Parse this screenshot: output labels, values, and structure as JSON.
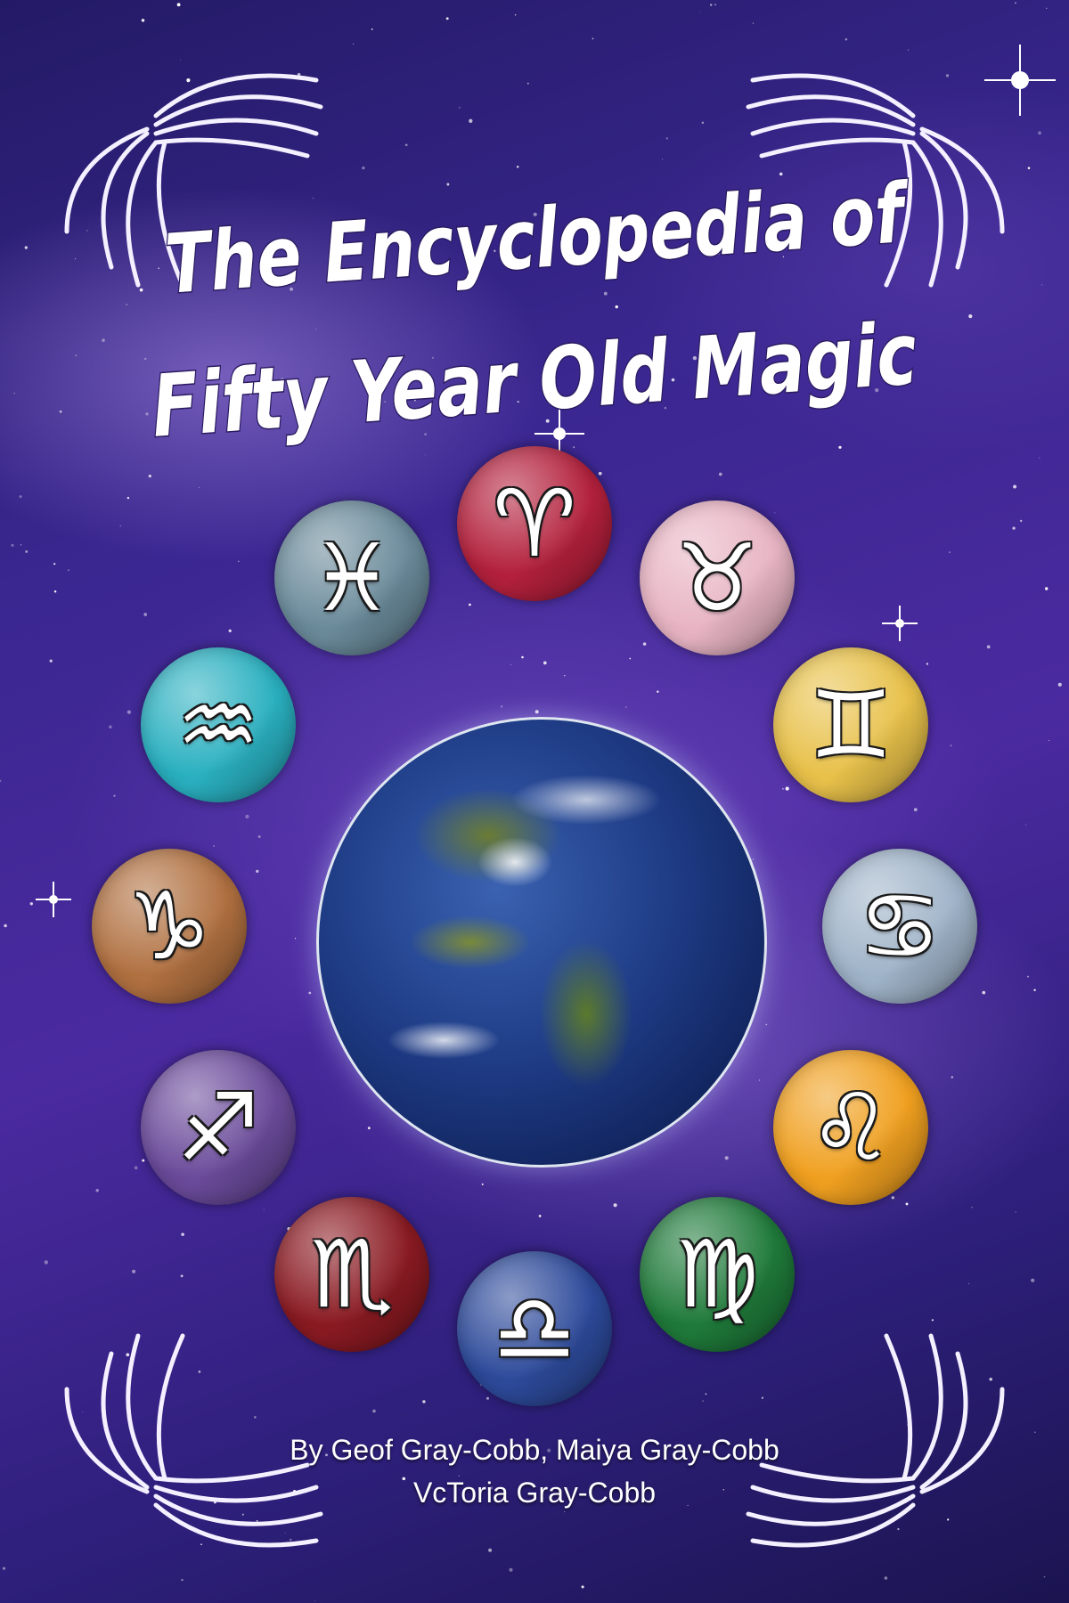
{
  "cover": {
    "title_line1": "The Encyclopedia of",
    "title_line2": "Fifty Year Old Magic",
    "authors_line1": "By Geof Gray-Cobb,  Maiya Gray-Cobb",
    "authors_line2": "VcToria Gray-Cobb"
  },
  "zodiac": [
    {
      "sign": "aries",
      "glyph": "♈",
      "color": "#b3203c"
    },
    {
      "sign": "taurus",
      "glyph": "♉",
      "color": "#e8b4c4"
    },
    {
      "sign": "gemini",
      "glyph": "♊",
      "color": "#e8c14a"
    },
    {
      "sign": "cancer",
      "glyph": "♋",
      "color": "#9fb3c8"
    },
    {
      "sign": "leo",
      "glyph": "♌",
      "color": "#f0a020"
    },
    {
      "sign": "virgo",
      "glyph": "♍",
      "color": "#1f7a3a"
    },
    {
      "sign": "libra",
      "glyph": "♎",
      "color": "#2d4a9a"
    },
    {
      "sign": "scorpio",
      "glyph": "♏",
      "color": "#8a1a22"
    },
    {
      "sign": "sagittarius",
      "glyph": "♐",
      "color": "#6a4a9a"
    },
    {
      "sign": "capricorn",
      "glyph": "♑",
      "color": "#b07040"
    },
    {
      "sign": "aquarius",
      "glyph": "♒",
      "color": "#2ab0c0"
    },
    {
      "sign": "pisces",
      "glyph": "♓",
      "color": "#6a8a9a"
    }
  ],
  "decor": {
    "wing_color": "#e8e4f4",
    "earth_label": "earth-globe"
  }
}
